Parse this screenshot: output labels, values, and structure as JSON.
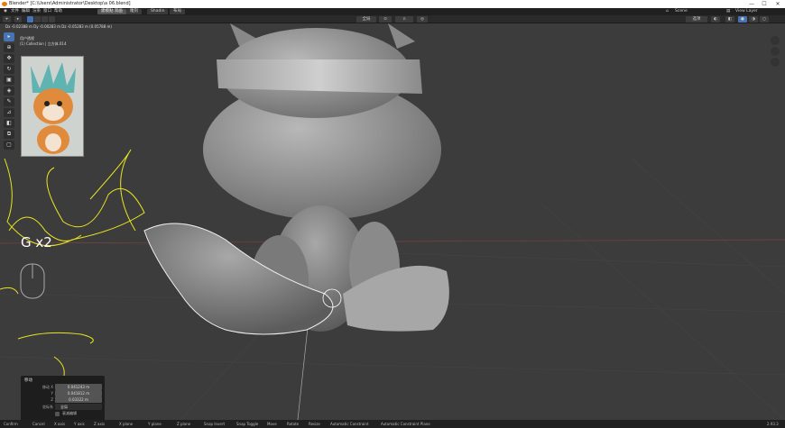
{
  "window": {
    "title": "Blender* [C:\\Users\\Administrator\\Desktop\\a 06.blend]",
    "min": "—",
    "max": "☐",
    "close": "✕"
  },
  "menu": {
    "items": [
      "文件",
      "编辑",
      "渲染",
      "窗口",
      "帮助"
    ],
    "tabs": [
      "建模贴 双画",
      "雕刻",
      "Shadin",
      "布局"
    ],
    "scene": "Scene",
    "view_layer": "View Layer"
  },
  "header": {
    "mode": "全局",
    "ops": [
      "选项"
    ]
  },
  "viewport": {
    "coords": "Dx -0.02388 m   Dy -0.00283 m   Dz -0.05283 m  (0.05788 m)",
    "stats": [
      "用户透视",
      "(1) Collection | 立方体.014"
    ],
    "overlay_key": "G x2"
  },
  "operator_panel": {
    "title": "移动",
    "fields": [
      {
        "label": "移动 X",
        "value": "0.041243 m"
      },
      {
        "label": "Y",
        "value": "0.041812 m"
      },
      {
        "label": "Z",
        "value": "0.03322 m"
      }
    ],
    "orientation_label": "坐标系",
    "orientation_value": "全局",
    "proportional_label": "衰减编辑"
  },
  "statusbar": {
    "items": [
      "Confirm",
      "Cancel",
      "X axis",
      "Y axis",
      "Z axis",
      "X plane",
      "Y plane",
      "Z plane",
      "Snap Invert",
      "Snap Toggle",
      "Move",
      "Rotate",
      "Resize",
      "Automatic Constraint",
      "Automatic Constraint Plane"
    ],
    "version": "2.93.3"
  },
  "colors": {
    "accent": "#4772b3",
    "viewport_bg": "#3c3c3c",
    "sketch": "#e8e520"
  }
}
